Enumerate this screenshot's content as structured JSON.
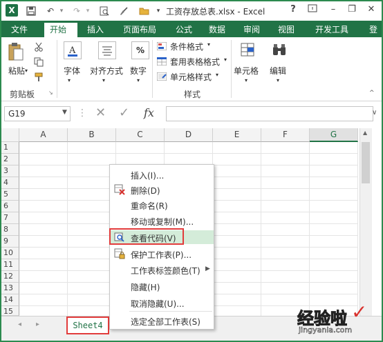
{
  "window": {
    "title": "工资存放总表.xlsx - Excel",
    "help": "?"
  },
  "ribbon_tabs": [
    "文件",
    "开始",
    "插入",
    "页面布局",
    "公式",
    "数据",
    "审阅",
    "视图",
    "开发工具",
    "登"
  ],
  "active_tab": "开始",
  "ribbon": {
    "paste": "粘贴",
    "font": "字体",
    "align": "对齐方式",
    "number": "数字",
    "cond_format": "条件格式",
    "table_format": "套用表格格式",
    "cell_style": "单元格样式",
    "styles_group": "样式",
    "cells": "单元格",
    "edit": "编辑",
    "clipboard_group": "剪贴板"
  },
  "formula_bar": {
    "name_box": "G19",
    "fx": "fx",
    "formula": ""
  },
  "columns": [
    "A",
    "B",
    "C",
    "D",
    "E",
    "F",
    "G"
  ],
  "selected_column": "G",
  "rows": [
    "1",
    "2",
    "3",
    "4",
    "5",
    "6",
    "7",
    "8",
    "9",
    "10",
    "11",
    "12",
    "13",
    "14",
    "15"
  ],
  "context_menu": [
    {
      "label": "插入(I)...",
      "icon": ""
    },
    {
      "label": "删除(D)",
      "icon": "delete-sheet-icon"
    },
    {
      "label": "重命名(R)",
      "icon": ""
    },
    {
      "label": "移动或复制(M)...",
      "icon": ""
    },
    {
      "label": "查看代码(V)",
      "icon": "view-code-icon"
    },
    {
      "label": "保护工作表(P)...",
      "icon": "protect-sheet-icon"
    },
    {
      "label": "工作表标签颜色(T)",
      "icon": ""
    },
    {
      "label": "隐藏(H)",
      "icon": ""
    },
    {
      "label": "取消隐藏(U)...",
      "icon": ""
    },
    {
      "label": "选定全部工作表(S)",
      "icon": ""
    }
  ],
  "highlighted_item": "查看代码(V)",
  "sheet_tab": "Sheet4",
  "watermark": {
    "text": "经验啦",
    "url": "jingyanla.com"
  },
  "colors": {
    "excel_green": "#217346",
    "highlight_red": "#e23b3b",
    "menu_hover": "#d4ecd9"
  }
}
